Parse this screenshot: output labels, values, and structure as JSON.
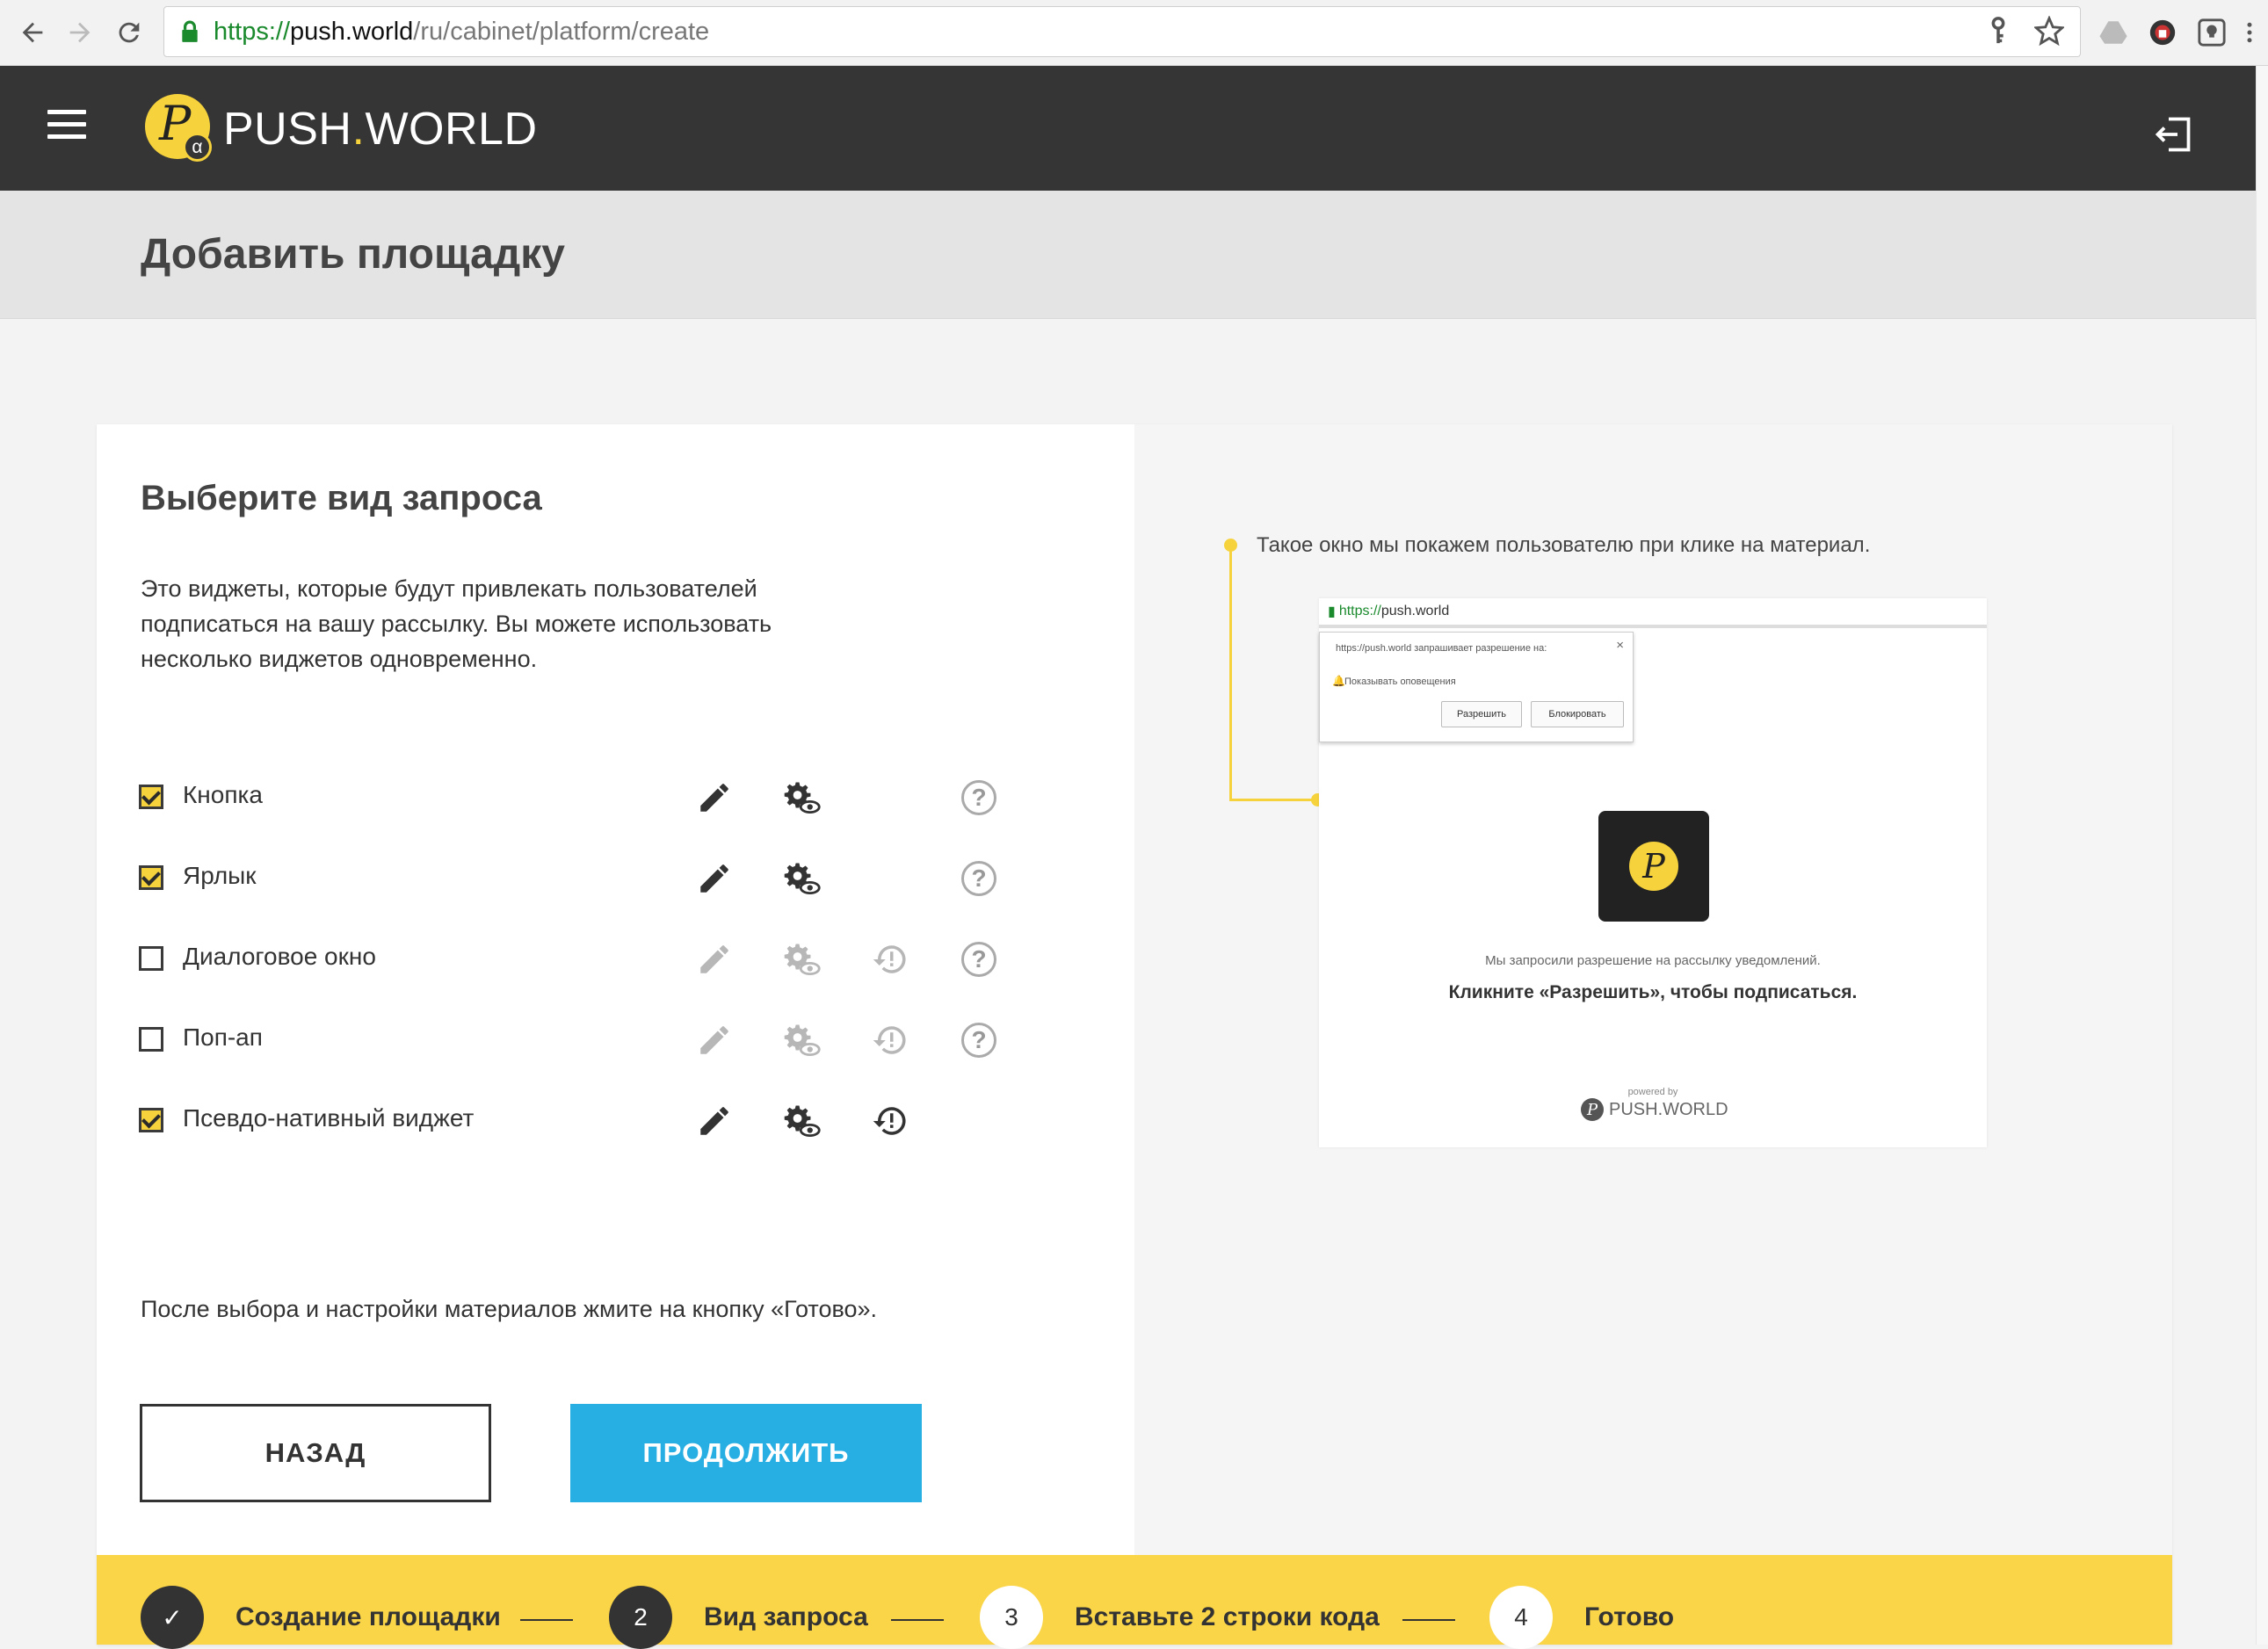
{
  "browser": {
    "url_scheme": "https://",
    "url_host": "push.world",
    "url_path": "/ru/cabinet/platform/create"
  },
  "header": {
    "logo_p": "P",
    "logo_alpha": "α",
    "logo_push": "PUSH",
    "logo_dot": ".",
    "logo_world": "WORLD",
    "accent_color": "#f6d23c",
    "bg_color": "#353535"
  },
  "page": {
    "title": "Добавить площадку"
  },
  "form": {
    "section_title": "Выберите вид запроса",
    "description": "Это виджеты, которые будут привлекать пользователей подписаться на вашу рассылку. Вы можете использовать несколько виджетов одновременно.",
    "widgets": [
      {
        "label": "Кнопка",
        "checked": true
      },
      {
        "label": "Ярлык",
        "checked": true
      },
      {
        "label": "Диалоговое окно",
        "checked": false
      },
      {
        "label": "Поп-ап",
        "checked": false
      },
      {
        "label": "Псевдо-нативный виджет",
        "checked": true
      }
    ],
    "help_glyph": "?",
    "after_text": "После выбора и настройки материалов жмите на кнопку «Готово».",
    "back_label": "НАЗАД",
    "next_label": "ПРОДОЛЖИТЬ",
    "next_color": "#27aee3"
  },
  "preview": {
    "caption": "Такое окно мы покажем пользователю при клике на материал.",
    "mock_url_scheme": "https://",
    "mock_url_host": "push.world",
    "popup_text": "https://push.world запрашивает разрешение на:",
    "popup_close": "×",
    "popup_notify": "Показывать оповещения",
    "popup_allow": "Разрешить",
    "popup_block": "Блокировать",
    "app_letter": "P",
    "small_text": "Мы запросили разрешение на рассылку уведомлений.",
    "big_text": "Кликните «Разрешить», чтобы подписаться.",
    "powered_by": "powered by",
    "brand": "PUSH.WORLD",
    "brand_letter": "P"
  },
  "steps": [
    {
      "number": "✓",
      "label": "Создание площадки",
      "state": "done"
    },
    {
      "number": "2",
      "label": "Вид запроса",
      "state": "current"
    },
    {
      "number": "3",
      "label": "Вставьте 2 строки кода",
      "state": "todo"
    },
    {
      "number": "4",
      "label": "Готово",
      "state": "todo"
    }
  ]
}
